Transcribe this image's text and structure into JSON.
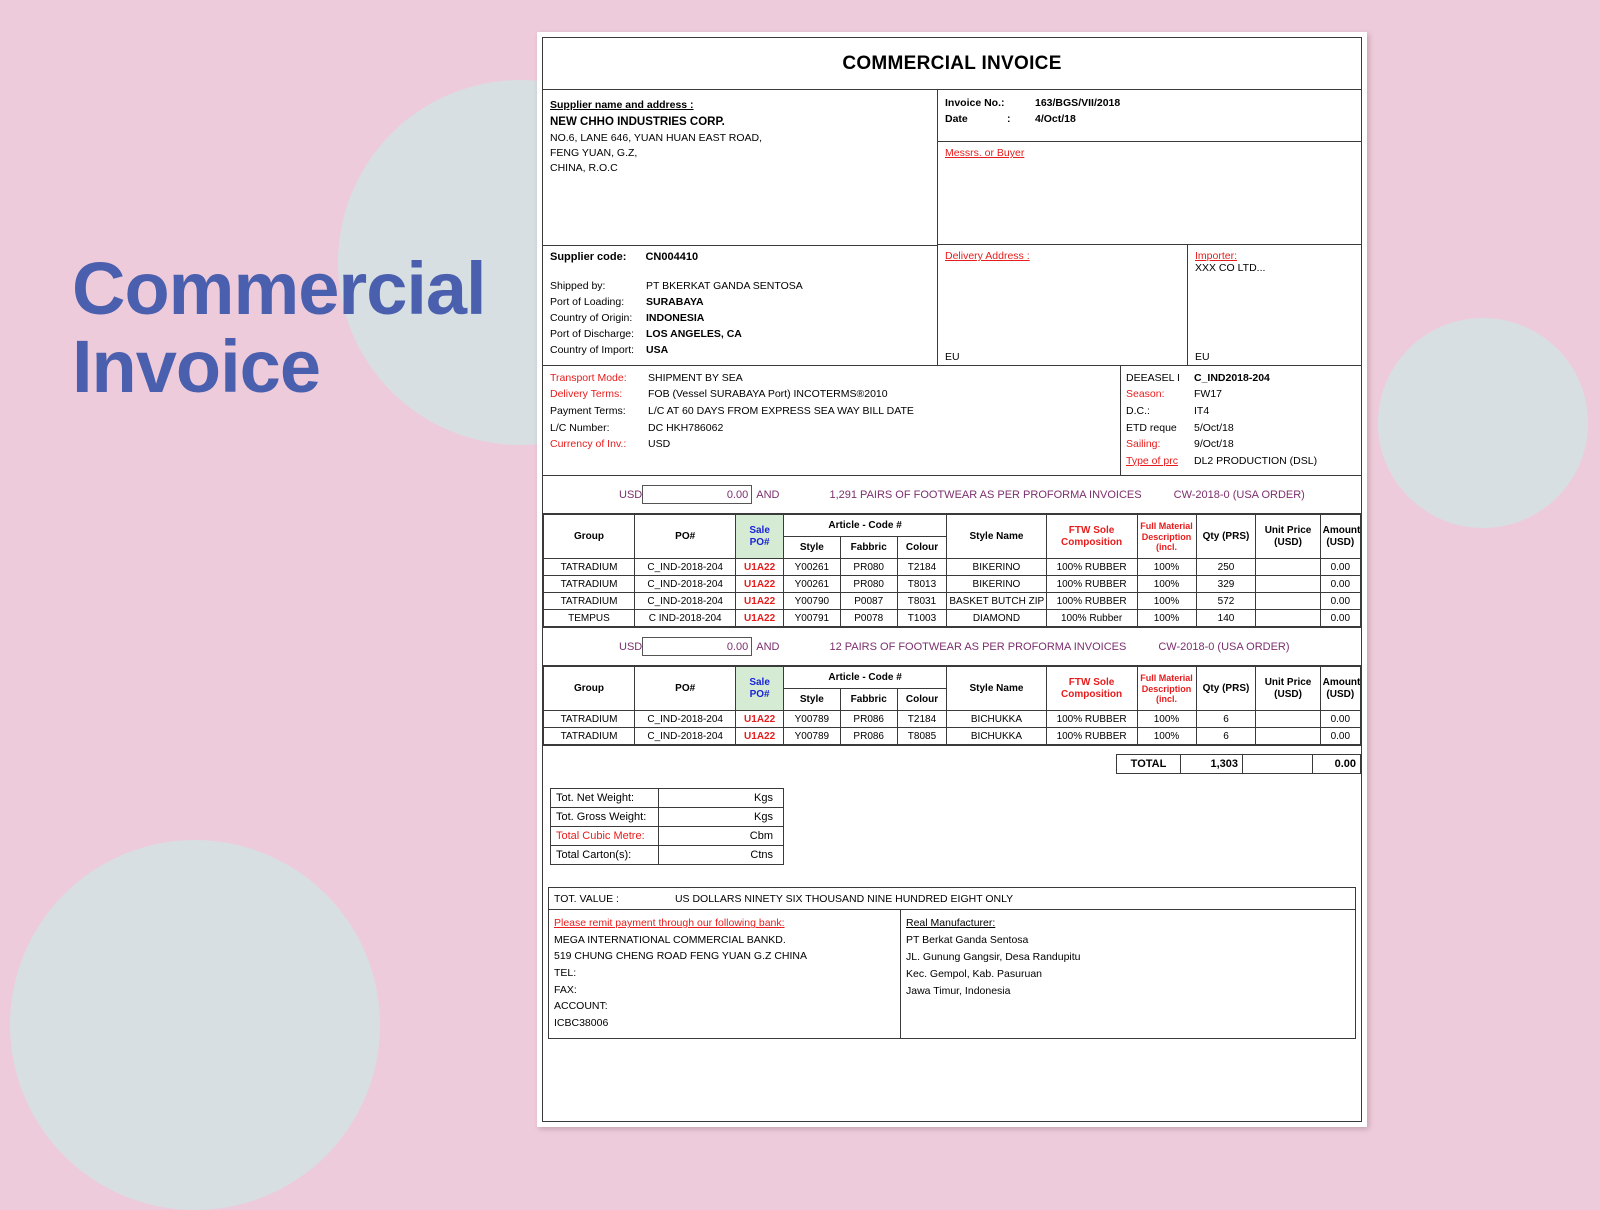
{
  "cover": {
    "title": "Commercial\nInvoice",
    "title_color": "#4a5fad",
    "background_color": "#eecbdb",
    "circle_color": "#d7dfe2"
  },
  "document": {
    "title": "COMMERCIAL INVOICE",
    "supplier": {
      "heading": "Supplier name and address :",
      "name": "NEW CHHO INDUSTRIES CORP.",
      "address_lines": [
        "NO.6, LANE 646, YUAN HUAN EAST ROAD,",
        "FENG YUAN, G.Z,",
        "CHINA, R.O.C"
      ],
      "code_label": "Supplier code:",
      "code_value": "CN004410"
    },
    "shipping": [
      {
        "label": "Shipped by:",
        "value": "PT BKERKAT GANDA SENTOSA",
        "bold": false
      },
      {
        "label": "Port of Loading:",
        "value": "SURABAYA",
        "bold": true
      },
      {
        "label": "Country of Origin:",
        "value": "INDONESIA",
        "bold": true
      },
      {
        "label": "Port of Discharge:",
        "value": "LOS ANGELES, CA",
        "bold": true
      },
      {
        "label": "Country of Import:",
        "value": "USA",
        "bold": true
      }
    ],
    "invoice_meta": [
      {
        "label": "Invoice No.:",
        "colon": "",
        "value": "163/BGS/VII/2018"
      },
      {
        "label": "Date",
        "colon": ":",
        "value": "4/Oct/18"
      }
    ],
    "buyer_heading": "Messrs. or Buyer",
    "delivery_address_heading": "Delivery Address :",
    "delivery_address_footer": "EU",
    "importer_heading": "Importer:",
    "importer_name": "XXX CO LTD...",
    "importer_footer": "EU",
    "terms_left": [
      {
        "label": "Transport Mode:",
        "value": "SHIPMENT BY SEA",
        "label_red": true
      },
      {
        "label": "Delivery Terms:",
        "value": "FOB (Vessel SURABAYA Port) INCOTERMS®2010",
        "label_red": true
      },
      {
        "label": "Payment Terms:",
        "value": "L/C AT 60 DAYS FROM EXPRESS SEA WAY BILL  DATE",
        "label_red": false
      },
      {
        "label": "L/C Number:",
        "value": "DC HKH786062",
        "label_red": false
      },
      {
        "label": "Currency of Inv.:",
        "value": "USD",
        "label_red": true
      }
    ],
    "terms_right": [
      {
        "label": "DEEASEL I",
        "value": "C_IND2018-204",
        "label_red": false,
        "bold": true
      },
      {
        "label": "Season:",
        "value": "FW17",
        "label_red": true,
        "bold": false
      },
      {
        "label": "D.C.:",
        "value": "IT4",
        "label_red": false,
        "bold": false
      },
      {
        "label": "ETD reque",
        "value": "5/Oct/18",
        "label_red": false,
        "bold": false
      },
      {
        "label": "Sailing:",
        "value": "9/Oct/18",
        "label_red": true,
        "bold": false
      },
      {
        "label": "Type of prc",
        "value": "DL2  PRODUCTION (DSL)",
        "label_red": true,
        "bold": false
      }
    ],
    "columns": {
      "group": "Group",
      "po": "PO#",
      "sale_po": "Sale\nPO#",
      "article": "Article - Code #",
      "style": "Style",
      "fabbric": "Fabbric",
      "colour": "Colour",
      "style_name": "Style Name",
      "sole": "FTW Sole\nComposition",
      "material": "Full Material\nDescription\n(incl.",
      "qty": "Qty (PRS)",
      "unit_price": "Unit Price\n(USD)",
      "amount": "Amount\n(USD)"
    },
    "sections": [
      {
        "currency": "USD",
        "amount_box": "0.00",
        "and": "AND",
        "phrase": "1,291  PAIRS OF FOOTWEAR AS PER PROFORMA INVOICES",
        "order": "CW-2018-0 (USA ORDER)",
        "rows": [
          {
            "group": "TATRADIUM",
            "po": "C_IND-2018-204",
            "sale_po": "U1A22",
            "style": "Y00261",
            "fabbric": "PR080",
            "colour": "T2184",
            "style_name": "BIKERINO",
            "sole": "100% RUBBER",
            "material": "100%",
            "qty": "250",
            "unit_price": "",
            "amount": "0.00"
          },
          {
            "group": "TATRADIUM",
            "po": "C_IND-2018-204",
            "sale_po": "U1A22",
            "style": "Y00261",
            "fabbric": "PR080",
            "colour": "T8013",
            "style_name": "BIKERINO",
            "sole": "100% RUBBER",
            "material": "100%",
            "qty": "329",
            "unit_price": "",
            "amount": "0.00"
          },
          {
            "group": "TATRADIUM",
            "po": "C_IND-2018-204",
            "sale_po": "U1A22",
            "style": "Y00790",
            "fabbric": "P0087",
            "colour": "T8031",
            "style_name": "BASKET BUTCH ZIP",
            "sole": "100% RUBBER",
            "material": "100%",
            "qty": "572",
            "unit_price": "",
            "amount": "0.00"
          },
          {
            "group": "TEMPUS",
            "po": "C IND-2018-204",
            "sale_po": "U1A22",
            "style": "Y00791",
            "fabbric": "P0078",
            "colour": "T1003",
            "style_name": "DIAMOND",
            "sole": "100% Rubber",
            "material": "100%",
            "qty": "140",
            "unit_price": "",
            "amount": "0.00"
          }
        ]
      },
      {
        "currency": "USD",
        "amount_box": "0.00",
        "and": "AND",
        "phrase": "12  PAIRS OF FOOTWEAR AS PER PROFORMA INVOICES",
        "order": "CW-2018-0 (USA ORDER)",
        "rows": [
          {
            "group": "TATRADIUM",
            "po": "C_IND-2018-204",
            "sale_po": "U1A22",
            "style": "Y00789",
            "fabbric": "PR086",
            "colour": "T2184",
            "style_name": "BICHUKKA",
            "sole": "100% RUBBER",
            "material": "100%",
            "qty": "6",
            "unit_price": "",
            "amount": "0.00"
          },
          {
            "group": "TATRADIUM",
            "po": "C_IND-2018-204",
            "sale_po": "U1A22",
            "style": "Y00789",
            "fabbric": "PR086",
            "colour": "T8085",
            "style_name": "BICHUKKA",
            "sole": "100% RUBBER",
            "material": "100%",
            "qty": "6",
            "unit_price": "",
            "amount": "0.00"
          }
        ]
      }
    ],
    "total": {
      "label": "TOTAL",
      "qty": "1,303",
      "unit_price": "",
      "amount": "0.00"
    },
    "weights": [
      {
        "label": "Tot. Net Weight:",
        "value": "",
        "unit": "Kgs",
        "label_red": false
      },
      {
        "label": "Tot. Gross Weight:",
        "value": "",
        "unit": "Kgs",
        "label_red": false
      },
      {
        "label": "Total Cubic Metre:",
        "value": "",
        "unit": "Cbm",
        "label_red": true
      },
      {
        "label": "Total Carton(s):",
        "value": "",
        "unit": "Ctns",
        "label_red": false
      }
    ],
    "tot_value_label": "TOT. VALUE :",
    "tot_value_words": "US DOLLARS NINETY SIX THOUSAND NINE HUNDRED EIGHT ONLY",
    "bank": {
      "heading": "Please remit payment  through our following bank:",
      "lines": [
        "MEGA INTERNATIONAL  COMMERCIAL  BANKD.",
        "519 CHUNG CHENG ROAD FENG YUAN G.Z CHINA",
        "TEL:",
        "FAX:",
        "ACCOUNT:",
        " ICBC38006"
      ]
    },
    "manufacturer": {
      "heading": "Real Manufacturer:",
      "lines": [
        "PT Berkat Ganda Sentosa",
        "JL. Gunung Gangsir, Desa Randupitu",
        "Kec. Gempol, Kab. Pasuruan",
        "Jawa Timur, Indonesia"
      ]
    }
  }
}
